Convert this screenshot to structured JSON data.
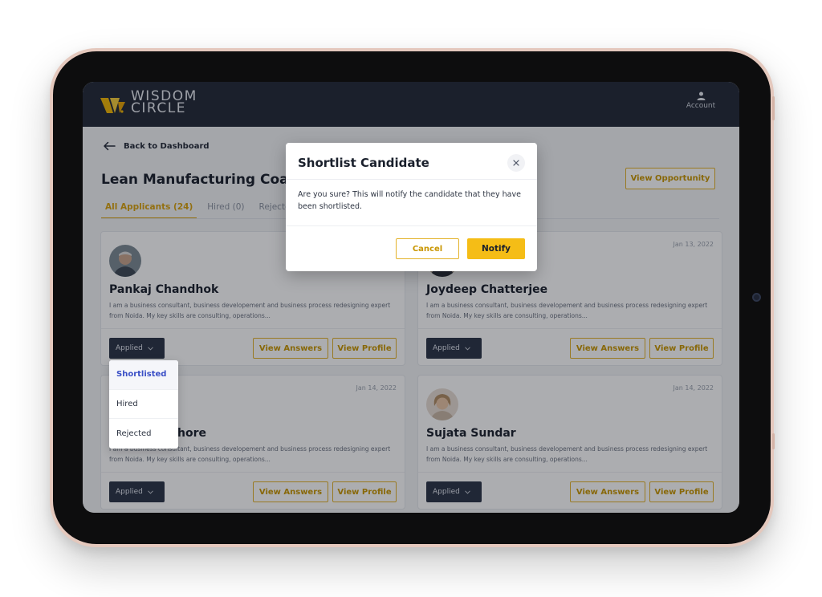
{
  "app": {
    "logo_line1": "WISDOM",
    "logo_line2": "CIRCLE",
    "account_label": "Account"
  },
  "page": {
    "back_label": "Back to Dashboard",
    "title": "Lean Manufacturing Coach",
    "view_opportunity_label": "View Opportunity",
    "tabs": [
      {
        "label": "All Applicants (24)",
        "active": true
      },
      {
        "label": "Hired (0)",
        "active": false
      },
      {
        "label": "Rejected",
        "active": false
      }
    ]
  },
  "candidates": [
    {
      "name": "Pankaj Chandhok",
      "date": "",
      "bio": "I am a business consultant, business developement and business process redesigning expert from Noida. My key skills are consulting, operations...",
      "status": "Applied"
    },
    {
      "name": "Joydeep Chatterjee",
      "date": "Jan 13, 2022",
      "bio": "I am a business consultant, business developement and business process redesigning expert from Noida. My key skills are consulting, operations...",
      "status": "Applied"
    },
    {
      "name": "hore",
      "date": "Jan 14, 2022",
      "bio": "I am a business consultant, business developement and business process redesigning expert from Noida. My key skills are consulting, operations...",
      "status": "Applied"
    },
    {
      "name": "Sujata Sundar",
      "date": "Jan 14, 2022",
      "bio": "I am a business consultant, business developement and business process redesigning expert from Noida. My key skills are consulting, operations...",
      "status": "Applied"
    }
  ],
  "card_actions": {
    "view_answers": "View Answers",
    "view_profile": "View Profile"
  },
  "status_menu": {
    "options": [
      "Shortlisted",
      "Hired",
      "Rejected"
    ],
    "selected": "Shortlisted"
  },
  "modal": {
    "title": "Shortlist Candidate",
    "body": "Are you sure? This will notify the candidate that they have been shortlisted.",
    "cancel_label": "Cancel",
    "notify_label": "Notify"
  },
  "colors": {
    "accent": "#f5bd16",
    "header_bg": "#232a38",
    "status_bg": "#2b3447"
  }
}
